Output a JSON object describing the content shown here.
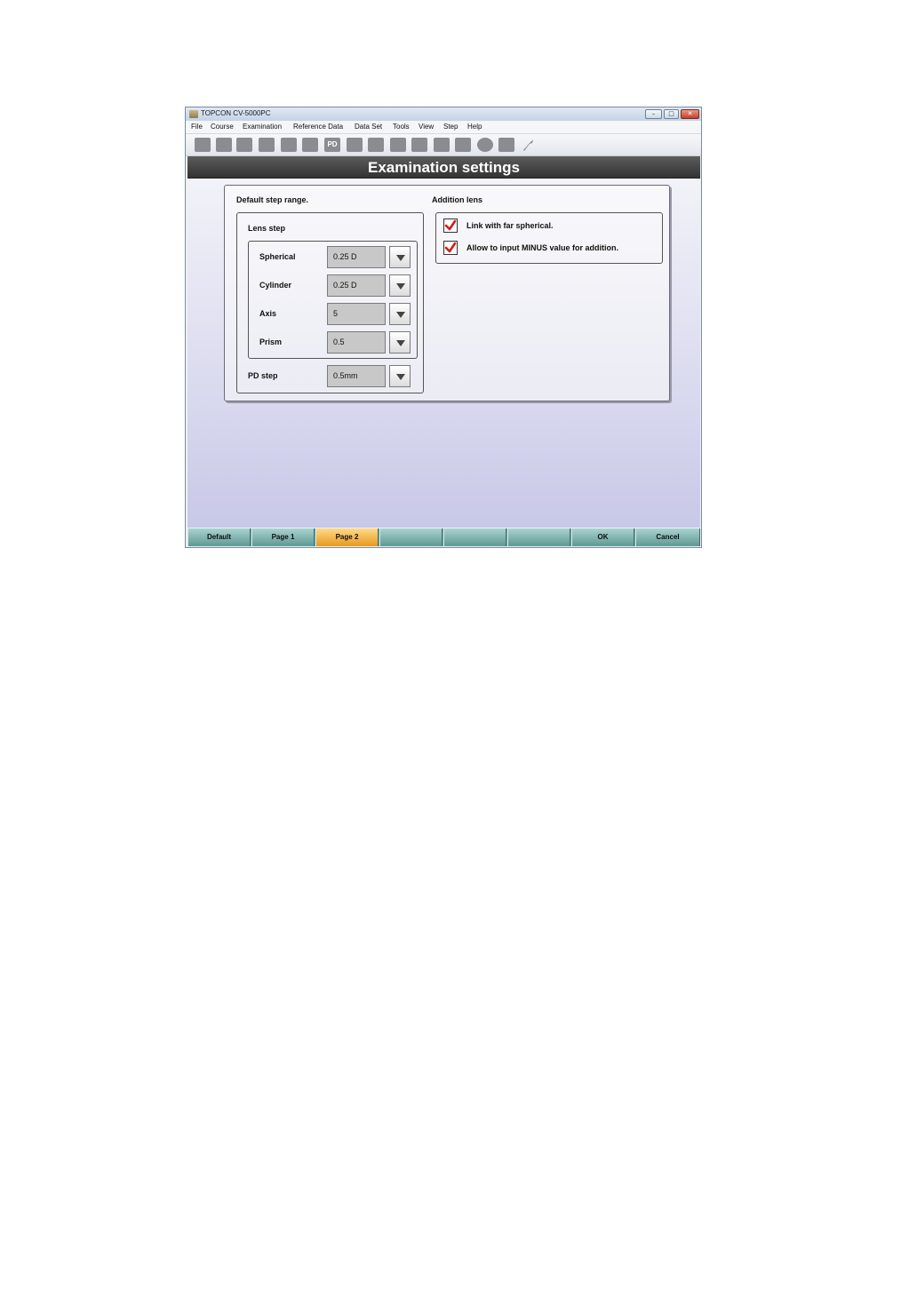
{
  "window": {
    "title": "TOPCON CV-5000PC",
    "minimize_glyph": "–",
    "maximize_glyph": "□",
    "close_glyph": "✕"
  },
  "menu": [
    "File",
    "Course",
    "Examination",
    "Reference Data",
    "Data Set",
    "Tools",
    "View",
    "Step",
    "Help"
  ],
  "toolbar": {
    "pd_label": "PD",
    "icons": [
      "patient-icon",
      "person-icon",
      "lens-icon",
      "glasses-icon",
      "chart-icon",
      "keyboard-icon",
      "pd-icon",
      "square-icon",
      "va-icon",
      "split-icon",
      "monitor-icon",
      "speech-icon",
      "book-icon",
      "circle-icon",
      "print-icon",
      "wrench-icon"
    ]
  },
  "header": {
    "title": "Examination settings"
  },
  "step_range": {
    "title": "Default step range.",
    "lens_step_title": "Lens step",
    "rows": [
      {
        "label": "Spherical",
        "value": "0.25 D"
      },
      {
        "label": "Cylinder",
        "value": "0.25 D"
      },
      {
        "label": "Axis",
        "value": "5"
      },
      {
        "label": "Prism",
        "value": "0.5"
      }
    ],
    "pd_step": {
      "label": "PD step",
      "value": "0.5mm"
    }
  },
  "addition_lens": {
    "title": "Addition lens",
    "options": [
      {
        "label": "Link with far spherical.",
        "checked": true
      },
      {
        "label": "Allow to input MINUS value for addition.",
        "checked": true
      }
    ]
  },
  "footer": {
    "buttons": [
      "Default",
      "Page 1",
      "Page 2",
      "",
      "",
      "",
      "OK",
      "Cancel"
    ],
    "active": "Page 2",
    "accent_active": "#f0b040",
    "accent_normal": "#7aa9a6"
  }
}
